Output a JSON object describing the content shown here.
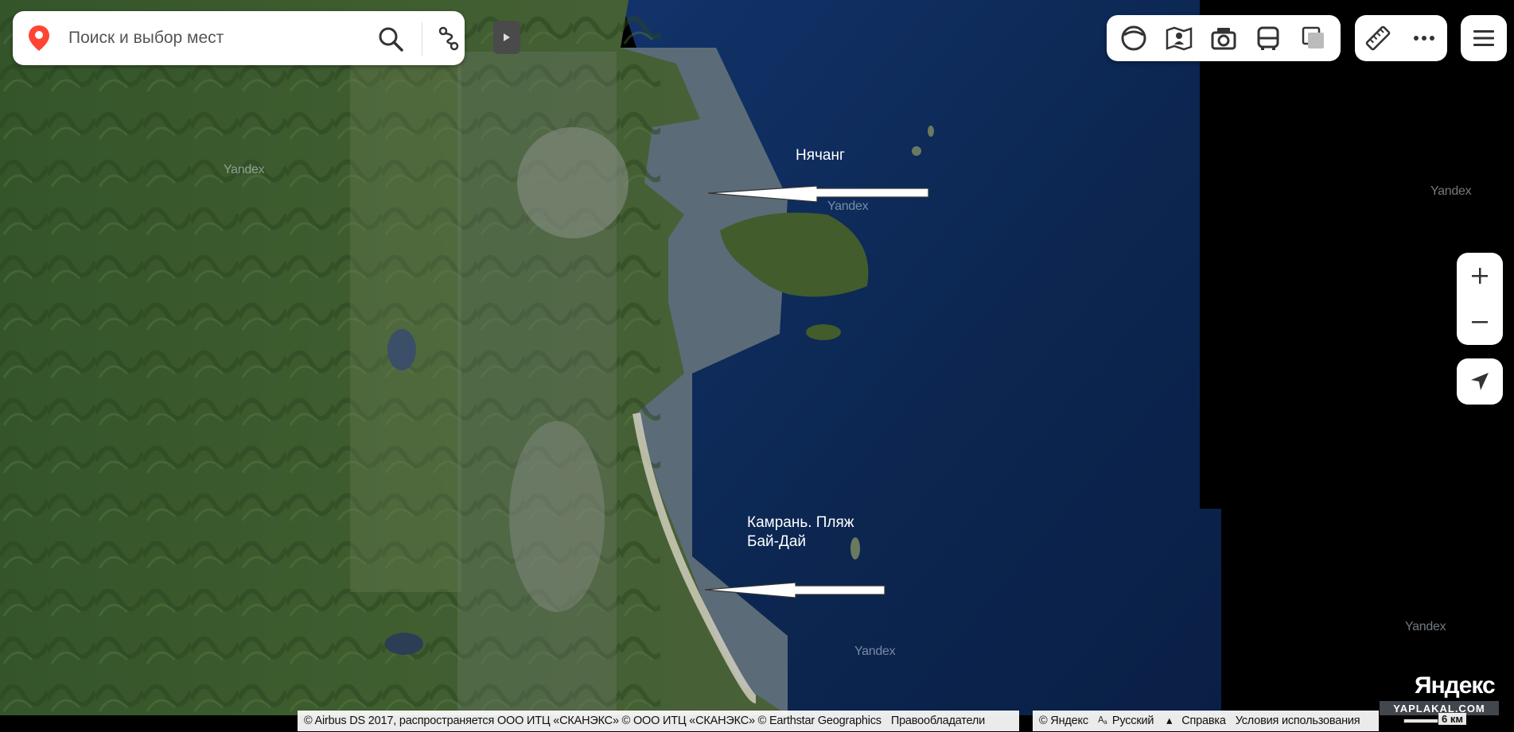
{
  "search": {
    "placeholder": "Поиск и выбор мест"
  },
  "map_labels": {
    "nha_trang": "Нячанг",
    "cam_ranh_line1": "Камрань. Пляж",
    "cam_ranh_line2": "Бай-Дай",
    "watermark": "Yandex"
  },
  "toolbar": {
    "icons": [
      "pano-icon",
      "map-selection-icon",
      "camera-icon",
      "bus-icon",
      "layers-icon",
      "ruler-icon",
      "more-icon",
      "menu-icon"
    ]
  },
  "attribution": {
    "sources": "© Airbus DS 2017, распространяется ООО ИТЦ «СКАНЭКС» © ООО ИТЦ «СКАНЭКС» © Earthstar Geographics",
    "owners": "Правообладатели",
    "copyright": "© Яндекс",
    "language": "Русский",
    "help": "Справка",
    "terms": "Условия использования"
  },
  "brand": "Яндекс",
  "site_stamp": "YAPLAKAL.COM",
  "scale": "6 км",
  "colors": {
    "sea": "#0c2752",
    "land": "#3d5a2c",
    "pin": "#f43",
    "no_data": "#000000"
  }
}
